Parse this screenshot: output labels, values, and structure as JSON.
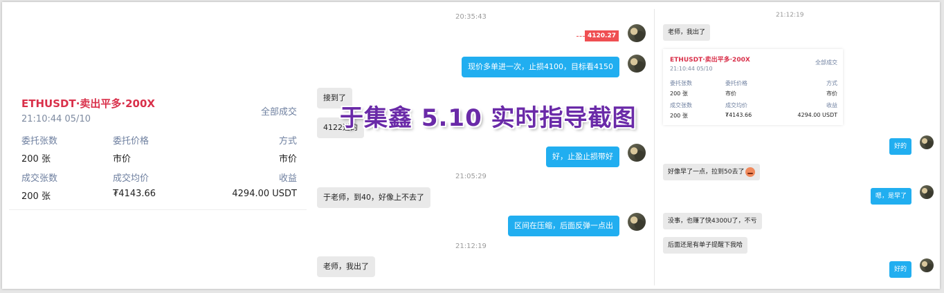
{
  "order_card": {
    "title": "ETHUSDT·卖出平多·200X",
    "time": "21:10:44 05/10",
    "status": "全部成交",
    "labels": {
      "order_qty": "委托张数",
      "order_price": "委托价格",
      "method": "方式",
      "filled_qty": "成交张数",
      "avg_price": "成交均价",
      "profit": "收益"
    },
    "values": {
      "order_qty": "200 张",
      "order_price": "市价",
      "method": "市价",
      "filled_qty": "200 张",
      "avg_price": "₮4143.66",
      "profit": "4294.00 USDT"
    }
  },
  "overlay_title": "于集鑫 5.10 实时指导截图",
  "chat_left": {
    "ts1": "20:35:43",
    "price_tag": "4120.27",
    "msg_out1": "现价多单进一次，止损4100，目标看4150",
    "msg_in1": "接到了",
    "msg_in2": "4122进的",
    "msg_out2": "好，止盈止损带好",
    "ts2": "21:05:29",
    "msg_in3": "于老师，到40，好像上不去了",
    "msg_out3": "区间在压缩，后面反弹一点出",
    "ts3": "21:12:19",
    "msg_in4": "老师，我出了"
  },
  "chat_right": {
    "ts1": "21:12:19",
    "msg_in1": "老师，我出了",
    "msg_out1": "好的",
    "msg_in2": "好像早了一点，拉到50去了",
    "msg_out2": "嗯，是早了",
    "msg_in3": "没事，也赚了快4300U了，不亏",
    "msg_in4": "后面还是有单子提醒下我哈",
    "msg_out3": "好的"
  },
  "colors": {
    "bubble_out": "#21aef0",
    "bubble_in": "#e9e9e9",
    "title_red": "#d9304a",
    "overlay": "#6a2aa8"
  }
}
